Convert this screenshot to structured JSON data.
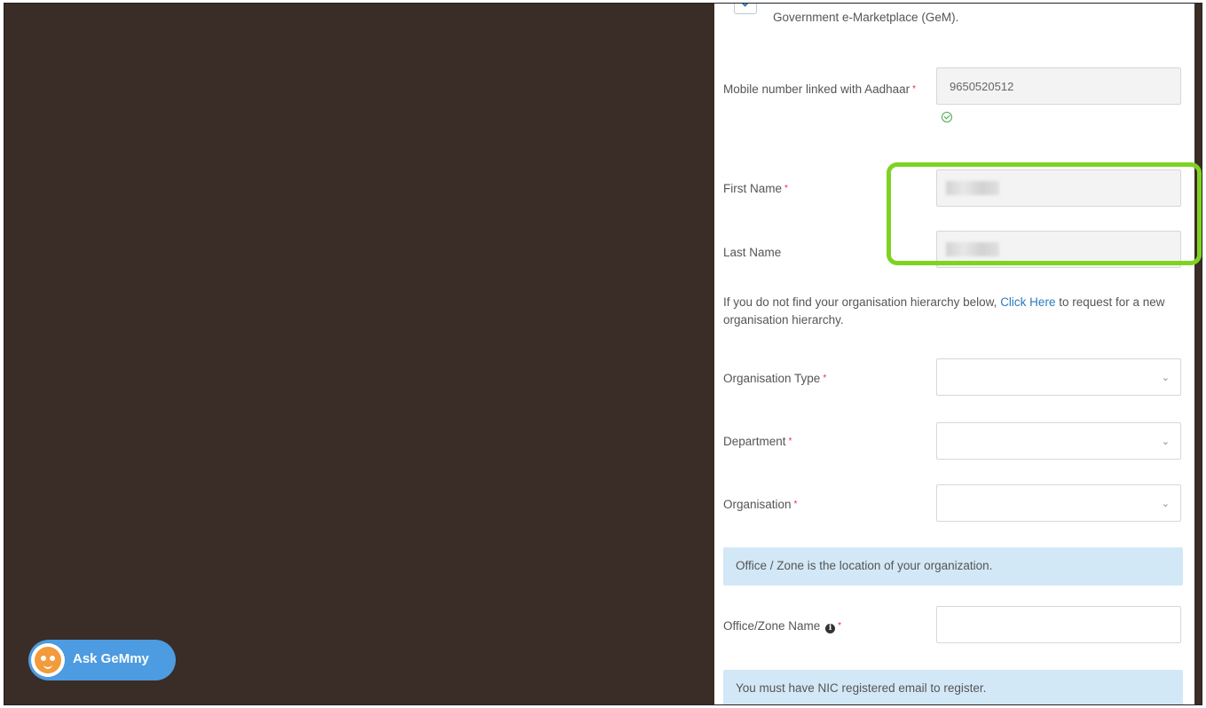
{
  "consent": {
    "text": "Government e-Marketplace (GeM)."
  },
  "mobile": {
    "label": "Mobile number linked with Aadhaar",
    "value": "9650520512"
  },
  "first_name": {
    "label": "First Name"
  },
  "last_name": {
    "label": "Last Name"
  },
  "hierarchy_help": {
    "before": "If you do not find your organisation hierarchy below, ",
    "link": "Click Here",
    "after": " to request for a new organisation hierarchy."
  },
  "org_type": {
    "label": "Organisation Type",
    "value": ""
  },
  "department": {
    "label": "Department",
    "value": ""
  },
  "organisation": {
    "label": "Organisation",
    "value": ""
  },
  "office_info": "Office / Zone is the location of your organization.",
  "office_zone": {
    "label": "Office/Zone Name",
    "value": ""
  },
  "nic_info": "You must have NIC registered email to register.",
  "required_marker": "*",
  "chatbot": {
    "label": "Ask GeMmy"
  },
  "colors": {
    "highlight": "#7ed321",
    "link": "#2a7bbf",
    "info_bg": "#d3e8f6",
    "chatbot": "#4d9be0"
  }
}
